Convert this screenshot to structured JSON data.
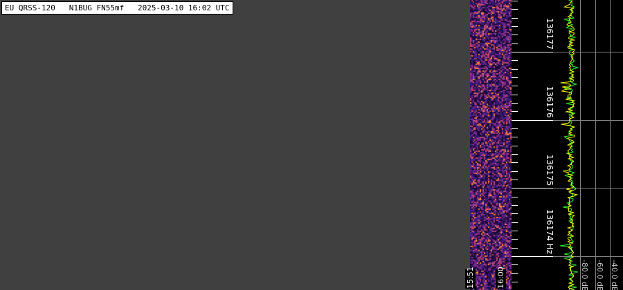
{
  "header": {
    "title": "EU QRSS-120   N1BUG FN55mf   2025-03-10 16:02 UTC"
  },
  "waterfall": {
    "time_labels": [
      "15:51",
      "16:00"
    ],
    "palette": [
      "#1a0838",
      "#3a1a78",
      "#7a2a88",
      "#c04870",
      "#ff8a30"
    ]
  },
  "frequency_axis": {
    "labels": [
      {
        "value": 136177,
        "text": "136177"
      },
      {
        "value": 136176,
        "text": "136176"
      },
      {
        "value": 136175,
        "text": "136175"
      },
      {
        "value": 136174,
        "text": "136174 Hz"
      }
    ],
    "range_hz": [
      136173.5,
      136177.75
    ]
  },
  "spectrum": {
    "db_labels": [
      "-80.0 dB",
      "-60.0 dB",
      "-40.0 dB"
    ],
    "trace_color": "#ffff00",
    "trace_color_secondary": "#33ff33"
  },
  "colors": {
    "background": "#404040",
    "panel": "#000000",
    "gridline": "#808080"
  }
}
